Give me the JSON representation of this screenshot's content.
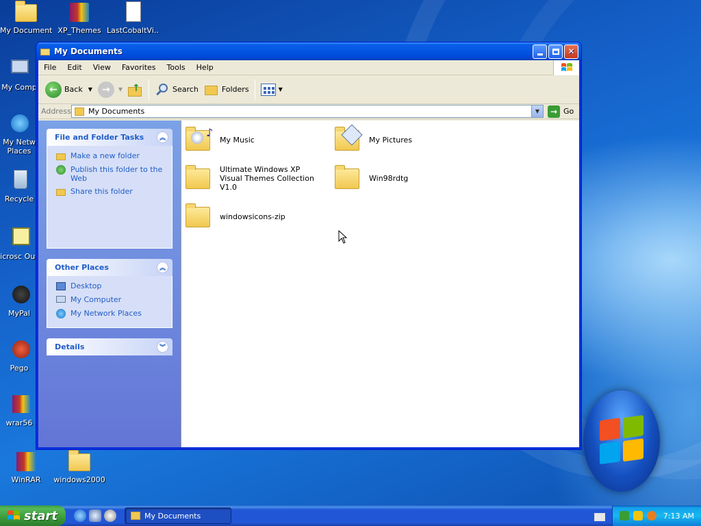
{
  "desktop": {
    "icons": [
      {
        "label": "My Documents"
      },
      {
        "label": "XP_Themes"
      },
      {
        "label": "LastCobaltVi..."
      },
      {
        "label": "My Comp"
      },
      {
        "label": "My Netw Places"
      },
      {
        "label": "Recycle"
      },
      {
        "label": "Microsc Outlo"
      },
      {
        "label": "MyPal"
      },
      {
        "label": "Pego"
      },
      {
        "label": "wrar56"
      },
      {
        "label": "WinRAR"
      },
      {
        "label": "windows2000"
      }
    ]
  },
  "window": {
    "title": "My Documents",
    "menu": [
      "File",
      "Edit",
      "View",
      "Favorites",
      "Tools",
      "Help"
    ],
    "toolbar": {
      "back": "Back",
      "search": "Search",
      "folders": "Folders"
    },
    "address": {
      "label": "Address",
      "value": "My Documents",
      "go": "Go"
    },
    "taskpane": {
      "file_tasks": {
        "title": "File and Folder Tasks",
        "items": [
          "Make a new folder",
          "Publish this folder to the Web",
          "Share this folder"
        ]
      },
      "other_places": {
        "title": "Other Places",
        "items": [
          "Desktop",
          "My Computer",
          "My Network Places"
        ]
      },
      "details": {
        "title": "Details"
      }
    },
    "files": [
      {
        "name": "My Music",
        "icon": "music-folder-icon"
      },
      {
        "name": "My Pictures",
        "icon": "pictures-folder-icon"
      },
      {
        "name": "Ultimate Windows XP Visual Themes Collection V1.0",
        "icon": "folder-icon"
      },
      {
        "name": "Win98rdtg",
        "icon": "folder-icon"
      },
      {
        "name": "windowsicons-zip",
        "icon": "folder-icon"
      }
    ]
  },
  "taskbar": {
    "start": "start",
    "task_button": "My Documents",
    "clock": "7:13 AM"
  },
  "colors": {
    "title_blue": "#0155e2",
    "taskpane_link": "#215dc6",
    "start_green": "#3a9b3a"
  }
}
